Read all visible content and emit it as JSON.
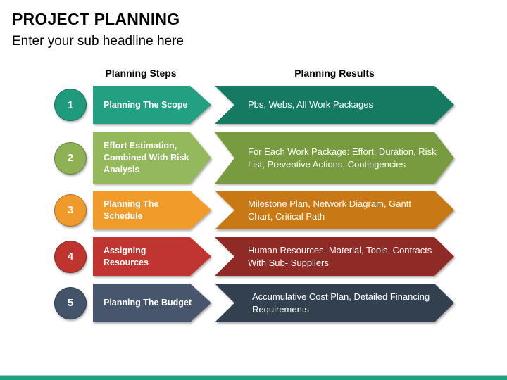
{
  "header": {
    "title": "PROJECT PLANNING",
    "subtitle": "Enter your sub headline here"
  },
  "columns": {
    "steps_label": "Planning Steps",
    "results_label": "Planning Results"
  },
  "rows": [
    {
      "number": "1",
      "step": "Planning The Scope",
      "result": "Pbs, Webs, All Work Packages",
      "colors": {
        "circle": "#1f9a7c",
        "step": "#21a081",
        "result": "#177a62"
      }
    },
    {
      "number": "2",
      "step": "Effort Estimation, Combined With Risk Analysis",
      "result": "For Each Work Package: Effort, Duration, Risk List, Preventive Actions, Contingencies",
      "colors": {
        "circle": "#8fb155",
        "step": "#94b85c",
        "result": "#789b40"
      }
    },
    {
      "number": "3",
      "step": "Planning The Schedule",
      "result": "Milestone Plan, Network Diagram, Gantt Chart, Critical Path",
      "colors": {
        "circle": "#ef9a2b",
        "step": "#f09b2c",
        "result": "#c87912"
      }
    },
    {
      "number": "4",
      "step": "Assigning Resources",
      "result": "Human Resources, Material, Tools, Contracts With Sub- Suppliers",
      "colors": {
        "circle": "#be3530",
        "step": "#c03632",
        "result": "#902a26"
      }
    },
    {
      "number": "5",
      "step": "Planning The Budget",
      "result": "Accumulative Cost Plan, Detailed Financing Requirements",
      "colors": {
        "circle": "#435369",
        "step": "#46566c",
        "result": "#333f50"
      }
    }
  ],
  "footer": {
    "bar_color": "#21a081"
  }
}
